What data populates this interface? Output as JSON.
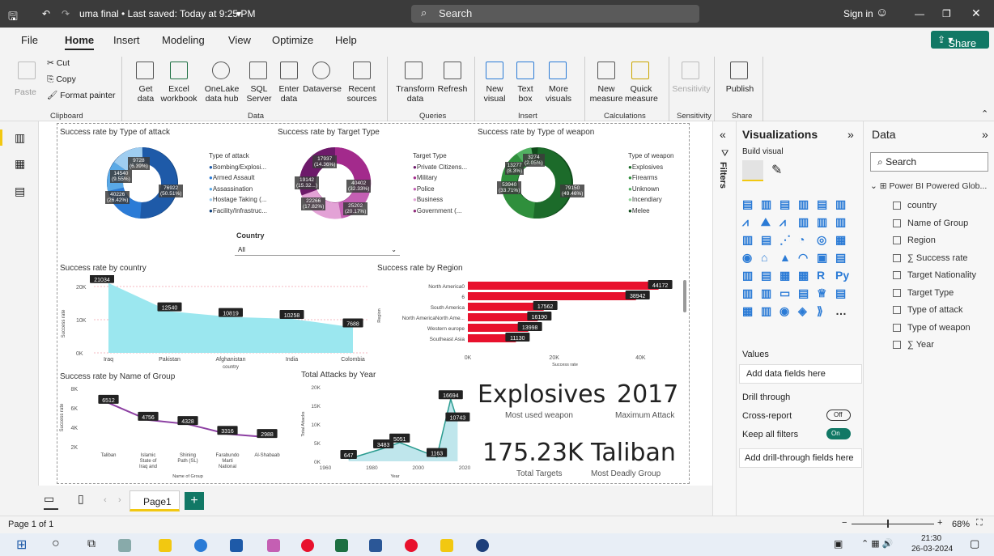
{
  "titlebar": {
    "filename": "uma final • Last saved: Today at 9:25 PM",
    "search": "Search",
    "signin": "Sign in"
  },
  "menu": [
    "File",
    "Home",
    "Insert",
    "Modeling",
    "View",
    "Optimize",
    "Help"
  ],
  "share": "Share",
  "ribbon": {
    "paste": "Paste",
    "cut": "Cut",
    "copy": "Copy",
    "format_painter": "Format painter",
    "get_data": "Get data",
    "excel": "Excel workbook",
    "onelake": "OneLake data hub",
    "sql": "SQL Server",
    "enter_data": "Enter data",
    "dataverse": "Dataverse",
    "recent": "Recent sources",
    "transform": "Transform data",
    "refresh": "Refresh",
    "new_visual": "New visual",
    "text_box": "Text box",
    "more_visuals": "More visuals",
    "new_measure": "New measure",
    "quick_measure": "Quick measure",
    "sensitivity": "Sensitivity",
    "publish": "Publish",
    "groups": {
      "clipboard": "Clipboard",
      "data": "Data",
      "queries": "Queries",
      "insert": "Insert",
      "calculations": "Calculations",
      "sensitivity": "Sensitivity",
      "share": "Share"
    }
  },
  "report": {
    "donut1": {
      "title": "Success rate by Type of attack",
      "legend_title": "Type of attack",
      "legend": [
        "Bombing/Explosi...",
        "Armed Assault",
        "Assassination",
        "Hostage Taking (...",
        "Facility/Infrastruc..."
      ],
      "labels": [
        "9728\n(6.39%)",
        "14540\n(9.55%)",
        "40226\n(26.42%)",
        "76922\n(50.51%)"
      ]
    },
    "donut2": {
      "title": "Success rate by Target Type",
      "legend_title": "Target Type",
      "legend": [
        "Private Citizens...",
        "Military",
        "Police",
        "Business",
        "Government (..."
      ],
      "labels": [
        "17937\n(14.36%)",
        "19142\n(15.32...)",
        "22266\n(17.82%)",
        "25202\n(20.17%)",
        "40402\n(32.33%)"
      ]
    },
    "donut3": {
      "title": "Success rate by Type of weapon",
      "legend_title": "Type of weapon",
      "legend": [
        "Explosives",
        "Firearms",
        "Unknown",
        "Incendiary",
        "Melee"
      ],
      "labels": [
        "3274\n(2.05%)",
        "13277\n(8.3%)",
        "53940\n(33.71%)",
        "79150\n(49.46%)"
      ]
    },
    "slicer": {
      "label": "Country",
      "value": "All"
    },
    "cards": {
      "weapon": "Explosives",
      "weapon_cap": "Most used weapon",
      "year": "2017",
      "year_cap": "Maximum Attack",
      "targets": "175.23K",
      "targets_cap": "Total Targets",
      "group": "Taliban",
      "group_cap": "Most Deadly Group"
    }
  },
  "chart_data": [
    {
      "type": "area",
      "title": "Success rate by country",
      "xlabel": "country",
      "ylabel": "Success rate",
      "categories": [
        "Iraq",
        "Pakistan",
        "Afghanistan",
        "India",
        "Colombia"
      ],
      "values": [
        21034,
        12540,
        10819,
        10258,
        7688
      ],
      "ylim": [
        0,
        20000
      ],
      "yticks": [
        "0K",
        "10K",
        "20K"
      ]
    },
    {
      "type": "bar",
      "title": "Success rate by Region",
      "xlabel": "Success rate",
      "ylabel": "Region",
      "categories": [
        "North America0",
        "6",
        "South America",
        "North AmericaNorth Ame...",
        "Western europe",
        "Southeast Asia"
      ],
      "values": [
        44172,
        38942,
        17562,
        16190,
        13998,
        11130
      ],
      "xlim": [
        0,
        45000
      ],
      "xticks": [
        "0K",
        "20K",
        "40K"
      ]
    },
    {
      "type": "line",
      "title": "Success rate by Name of Group",
      "xlabel": "Name of Group",
      "ylabel": "Success rate",
      "categories": [
        "Taliban",
        "Islamic State of Iraq and the Levant...",
        "Shining Path (SL)",
        "Farabundo Marti National Li...",
        "Al-Shabaab"
      ],
      "values": [
        6512,
        4756,
        4328,
        3316,
        2988
      ],
      "ylim": [
        2000,
        8000
      ],
      "yticks": [
        "2K",
        "4K",
        "6K",
        "8K"
      ]
    },
    {
      "type": "area",
      "title": "Total Attacks by Year",
      "xlabel": "Year",
      "ylabel": "Total Attacks",
      "labeled_points": [
        {
          "x": 1970,
          "y": 647
        },
        {
          "x": 1985,
          "y": 3483
        },
        {
          "x": 1992,
          "y": 5051
        },
        {
          "x": 2008,
          "y": 1163
        },
        {
          "x": 2014,
          "y": 16694
        },
        {
          "x": 2017,
          "y": 10743
        }
      ],
      "xlim": [
        1960,
        2020
      ],
      "ylim": [
        0,
        20000
      ],
      "xticks": [
        "1960",
        "1980",
        "2000",
        "2020"
      ],
      "yticks": [
        "0K",
        "5K",
        "10K",
        "15K",
        "20K"
      ]
    }
  ],
  "viz": {
    "title": "Visualizations",
    "build": "Build visual",
    "values": "Values",
    "add_fields": "Add data fields here",
    "drill": "Drill through",
    "cross": "Cross-report",
    "cross_state": "Off",
    "keep": "Keep all filters",
    "keep_state": "On",
    "add_drill": "Add drill-through fields here",
    "filters": "Filters"
  },
  "data": {
    "title": "Data",
    "search": "Search",
    "table": "Power BI Powered Glob...",
    "fields": [
      "country",
      "Name of Group",
      "Region",
      "Success rate",
      "Target Nationality",
      "Target Type",
      "Type of attack",
      "Type of weapon",
      "Year"
    ]
  },
  "tabs": {
    "page": "Page1"
  },
  "status": {
    "page": "Page 1 of 1",
    "zoom": "68%"
  },
  "taskbar": {
    "time": "21:30",
    "date": "26-03-2024"
  },
  "colors": {
    "accent": "#f2c811",
    "donut1": [
      "#1e5aa8",
      "#2b7bd6",
      "#5aa9e6",
      "#9fcdf0",
      "#0e3f7a"
    ],
    "donut2": [
      "#6d1a6a",
      "#a32a8c",
      "#c45fb3",
      "#e3a2d6",
      "#8f2b7a"
    ],
    "donut3": [
      "#1c6b2a",
      "#2f8f3c",
      "#52b062",
      "#93d49b",
      "#0f4a1a"
    ],
    "area": "#9be7ef",
    "bar": "#e8112d",
    "line": "#8c3fa2"
  }
}
